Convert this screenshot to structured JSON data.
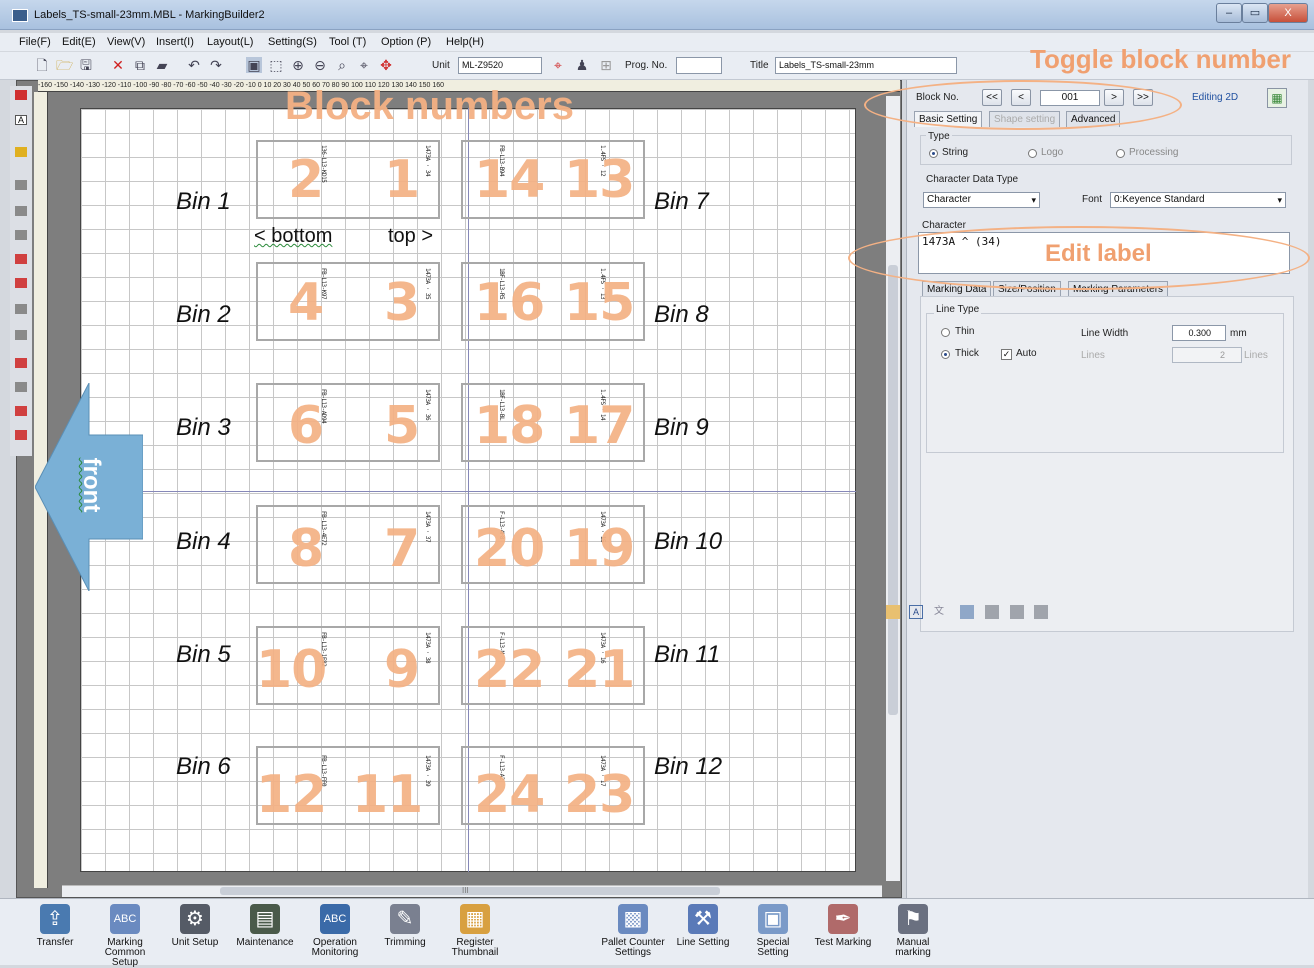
{
  "window": {
    "title": "Labels_TS-small-23mm.MBL - MarkingBuilder2",
    "min": "–",
    "max": "▭",
    "close": "X"
  },
  "menu": [
    "File(F)",
    "Edit(E)",
    "View(V)",
    "Insert(I)",
    "Layout(L)",
    "Setting(S)",
    "Tool (T)",
    "Option (P)",
    "Help(H)"
  ],
  "toolbar": {
    "unit_label": "Unit",
    "unit_value": "ML-Z9520",
    "prog_label": "Prog. No.",
    "prog_value": "",
    "title_label": "Title",
    "title_value": "Labels_TS-small-23mm"
  },
  "ruler_text": "-160 -150 -140 -130 -120 -110 -100 -90 -80 -70 -60 -50 -40 -30 -20 -10 0 10 20 30 40 50 60 70 80 90 100 110 120 130 140 150 160",
  "annotations": {
    "block_numbers": "Block numbers",
    "toggle_block_number": "Toggle block number",
    "edit_label": "Edit label",
    "front": "front"
  },
  "labels": {
    "bottom": "< bottom",
    "top": "top >"
  },
  "bins": [
    "Bin 1",
    "Bin 2",
    "Bin 3",
    "Bin 4",
    "Bin 5",
    "Bin 6",
    "Bin 7",
    "Bin 8",
    "Bin 9",
    "Bin 10",
    "Bin 11",
    "Bin 12"
  ],
  "block_nums": [
    "2",
    "1",
    "14",
    "13",
    "4",
    "3",
    "16",
    "15",
    "6",
    "5",
    "18",
    "17",
    "8",
    "7",
    "20",
    "19",
    "10",
    "9",
    "22",
    "21",
    "12",
    "11",
    "24",
    "23"
  ],
  "strip_texts": [
    "136-L13-KD15",
    "1473A · 34",
    "FB-L13-B94",
    "1.4FS · 12",
    "FB-L13-K97",
    "1473A · 35",
    "1BF-L13-R5",
    "1.4FS · 13",
    "FB-L13-AD94",
    "1473A · 36",
    "1BF-L13-BL",
    "1.4FS · 14",
    "FB-L13-4E72",
    "1473A · 37",
    "F-L13-4F8",
    "1473A · 15",
    "FB-L13-1F82",
    "1473A · 38",
    "F-L13-M",
    "1473A · 16",
    "FB-L13-FF0",
    "1473A · 39",
    "F-L13-A2",
    "1473A · 17"
  ],
  "panel": {
    "block_no_label": "Block No.",
    "block_no_value": "001",
    "nav": [
      "<<",
      "<",
      ">",
      ">>"
    ],
    "editing": "Editing 2D",
    "tabs": [
      "Basic Setting",
      "Shape setting",
      "Advanced"
    ],
    "type_label": "Type",
    "type_options": [
      "String",
      "Logo",
      "Processing"
    ],
    "char_data_label": "Character Data Type",
    "char_data_value": "Character",
    "font_label": "Font",
    "font_value": "0:Keyence Standard",
    "character_label": "Character",
    "character_value": "1473A ^ (34)",
    "sub_tabs": [
      "Marking Data",
      "Size/Position",
      "Marking Parameters"
    ],
    "line_type_label": "Line Type",
    "thin": "Thin",
    "thick": "Thick",
    "auto": "Auto",
    "line_width_label": "Line Width",
    "line_width_value": "0.300",
    "mm": "mm",
    "lines_label": "Lines",
    "lines_value": "2",
    "lines_unit": "Lines"
  },
  "bottom_bar": [
    "Transfer",
    "Marking Common Setup",
    "Unit Setup",
    "Maintenance",
    "Operation Monitoring",
    "Trimming",
    "Register Thumbnail",
    "Pallet Counter Settings",
    "Line Setting",
    "Special Setting",
    "Test Marking",
    "Manual marking"
  ],
  "scroll_mark": "III"
}
